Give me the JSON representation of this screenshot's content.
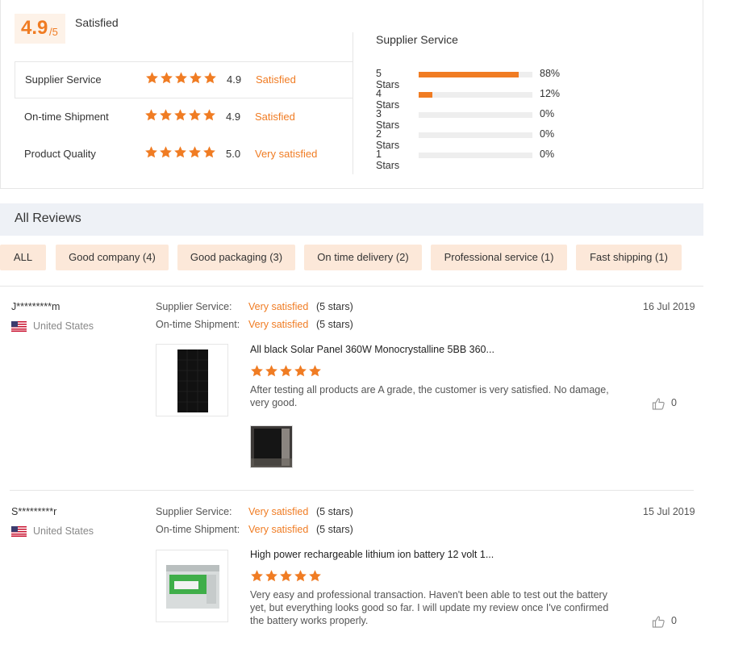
{
  "summary": {
    "score": "4.9",
    "score_suffix": "/5",
    "overall_label": "Satisfied",
    "metrics": [
      {
        "label": "Supplier Service",
        "score": "4.9",
        "status": "Satisfied",
        "stars": 5
      },
      {
        "label": "On-time Shipment",
        "score": "4.9",
        "status": "Satisfied",
        "stars": 5
      },
      {
        "label": "Product Quality",
        "score": "5.0",
        "status": "Very satisfied",
        "stars": 5
      }
    ],
    "distribution_title": "Supplier Service",
    "distribution": [
      {
        "label": "5  Stars",
        "pct": "88%",
        "value": 0.88
      },
      {
        "label": "4  Stars",
        "pct": "12%",
        "value": 0.12
      },
      {
        "label": "3  Stars",
        "pct": "0%",
        "value": 0
      },
      {
        "label": "2  Stars",
        "pct": "0%",
        "value": 0
      },
      {
        "label": "1  Stars",
        "pct": "0%",
        "value": 0
      }
    ]
  },
  "all_reviews": {
    "title": "All Reviews",
    "filters": [
      "ALL",
      "Good company (4)",
      "Good packaging (3)",
      "On time delivery (2)",
      "Professional service (1)",
      "Fast shipping (1)"
    ]
  },
  "reviews": [
    {
      "user": "J*********m",
      "country": "United States",
      "supplier_label": "Supplier Service:",
      "supplier_value": "Very satisfied",
      "supplier_stars": "(5 stars)",
      "shipment_label": "On-time Shipment:",
      "shipment_value": "Very satisfied",
      "shipment_stars": "(5 stars)",
      "date": "16 Jul 2019",
      "product_title": "All black Solar Panel 360W Monocrystalline 5BB 360...",
      "text": "After testing all products are A grade, the customer is very satisfied. No damage,very good.",
      "likes": "0"
    },
    {
      "user": "S*********r",
      "country": "United States",
      "supplier_label": "Supplier Service:",
      "supplier_value": "Very satisfied",
      "supplier_stars": "(5 stars)",
      "shipment_label": "On-time Shipment:",
      "shipment_value": "Very satisfied",
      "shipment_stars": "(5 stars)",
      "date": "15 Jul 2019",
      "product_title": "High power rechargeable lithium ion battery 12 volt 1...",
      "text": "Very easy and professional transaction. Haven't been able to test out the battery yet, but everything looks good so far. I will update my review once I've confirmed the battery works properly.",
      "likes": "0"
    }
  ],
  "colors": {
    "accent": "#f07c23",
    "chip_bg": "#fce8d9",
    "header_bg": "#eef1f6"
  },
  "icons": {
    "star": "star-icon",
    "flag": "us-flag-icon",
    "like": "thumbs-up-icon"
  }
}
